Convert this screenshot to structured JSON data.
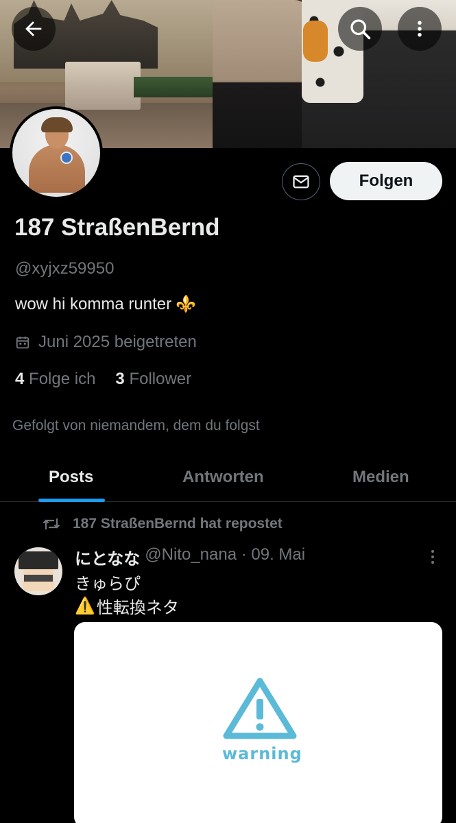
{
  "profile": {
    "display_name": "187 StraßenBernd",
    "handle": "@xyjxz59950",
    "bio": "wow hi komma runter",
    "bio_emoji": "⚜️",
    "joined": "Juni 2025 beigetreten",
    "following_count": "4",
    "following_label": "Folge ich",
    "followers_count": "3",
    "followers_label": "Follower",
    "followed_by": "Gefolgt von niemandem, dem du folgst"
  },
  "actions": {
    "follow_label": "Folgen"
  },
  "tabs": [
    {
      "label": "Posts",
      "active": true
    },
    {
      "label": "Antworten",
      "active": false
    },
    {
      "label": "Medien",
      "active": false
    }
  ],
  "feed": {
    "repost_label": "187 StraßenBernd hat repostet",
    "post": {
      "author_name": "にとなな",
      "author_meta": "@Nito_nana · 09. Mai",
      "text_line1": "きゅらぴ",
      "text_line2": "性転換ネタ",
      "text_line2_emoji": "⚠️",
      "media_label": "warning"
    }
  },
  "icons": {
    "back": "arrow-left-icon",
    "search": "search-icon",
    "more": "more-vertical-icon",
    "message": "envelope-icon",
    "calendar": "calendar-icon",
    "repost": "repost-icon",
    "warning": "warning-triangle-icon"
  },
  "colors": {
    "background": "#000000",
    "accent": "#1d9bf0",
    "text_primary": "#e7e9ea",
    "text_secondary": "#71767b",
    "warning": "#5bbad8"
  }
}
